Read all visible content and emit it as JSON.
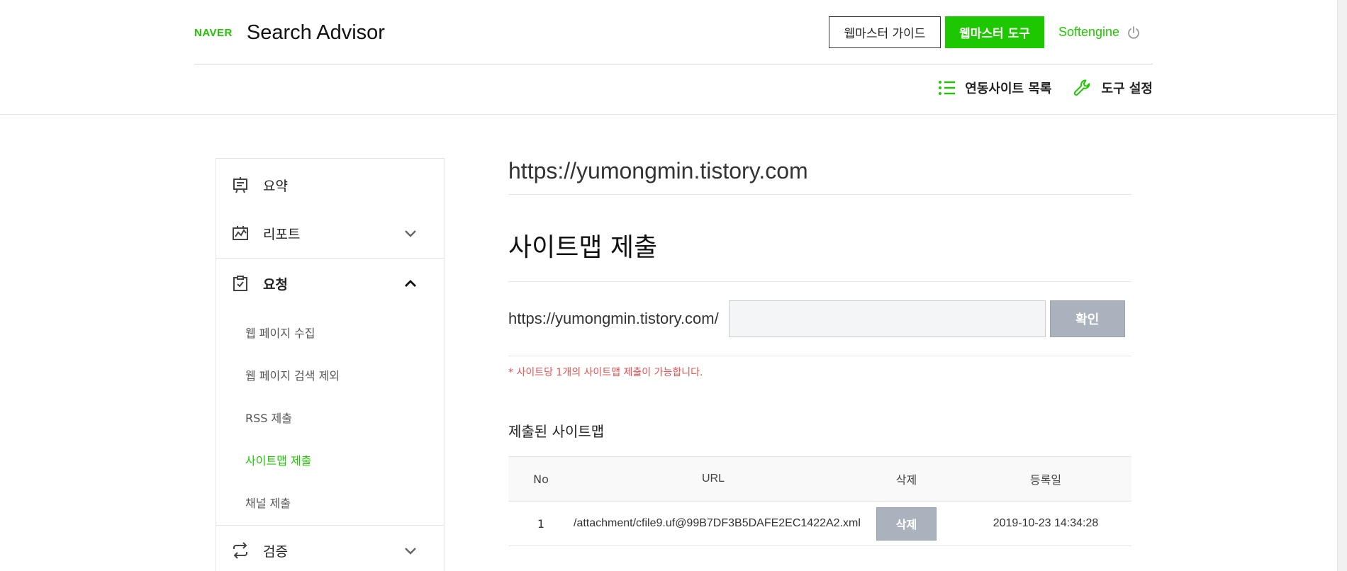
{
  "header": {
    "logo_brand": "NAVER",
    "logo_title": "Search Advisor",
    "guide_button": "웹마스터 가이드",
    "tool_button": "웹마스터 도구",
    "user_name": "Softengine",
    "power_icon": "power-icon"
  },
  "sub_nav": {
    "sites_list": "연동사이트 목록",
    "tool_settings": "도구 설정"
  },
  "sidebar": {
    "summary": "요약",
    "report": "리포트",
    "request": "요청",
    "request_items": [
      "웹 페이지 수집",
      "웹 페이지 검색 제외",
      "RSS 제출",
      "사이트맵 제출",
      "채널 제출"
    ],
    "active_item": "사이트맵 제출",
    "verify": "검증"
  },
  "main": {
    "site_url": "https://yumongmin.tistory.com",
    "section_title": "사이트맵 제출",
    "url_prefix": "https://yumongmin.tistory.com/",
    "input_value": "",
    "confirm_button": "확인",
    "notice": "* 사이트당 1개의 사이트맵 제출이 가능합니다.",
    "list_title": "제출된 사이트맵",
    "table": {
      "headers": [
        "No",
        "URL",
        "삭제",
        "등록일"
      ],
      "rows": [
        {
          "no": "1",
          "url": "/attachment/cfile9.uf@99B7DF3B5DAFE2EC1422A2.xml",
          "delete": "삭제",
          "date": "2019-10-23 14:34:28"
        }
      ]
    }
  },
  "colors": {
    "accent": "#1ec800",
    "notice": "#f04e4e",
    "disabled_button": "#aab2bd"
  }
}
